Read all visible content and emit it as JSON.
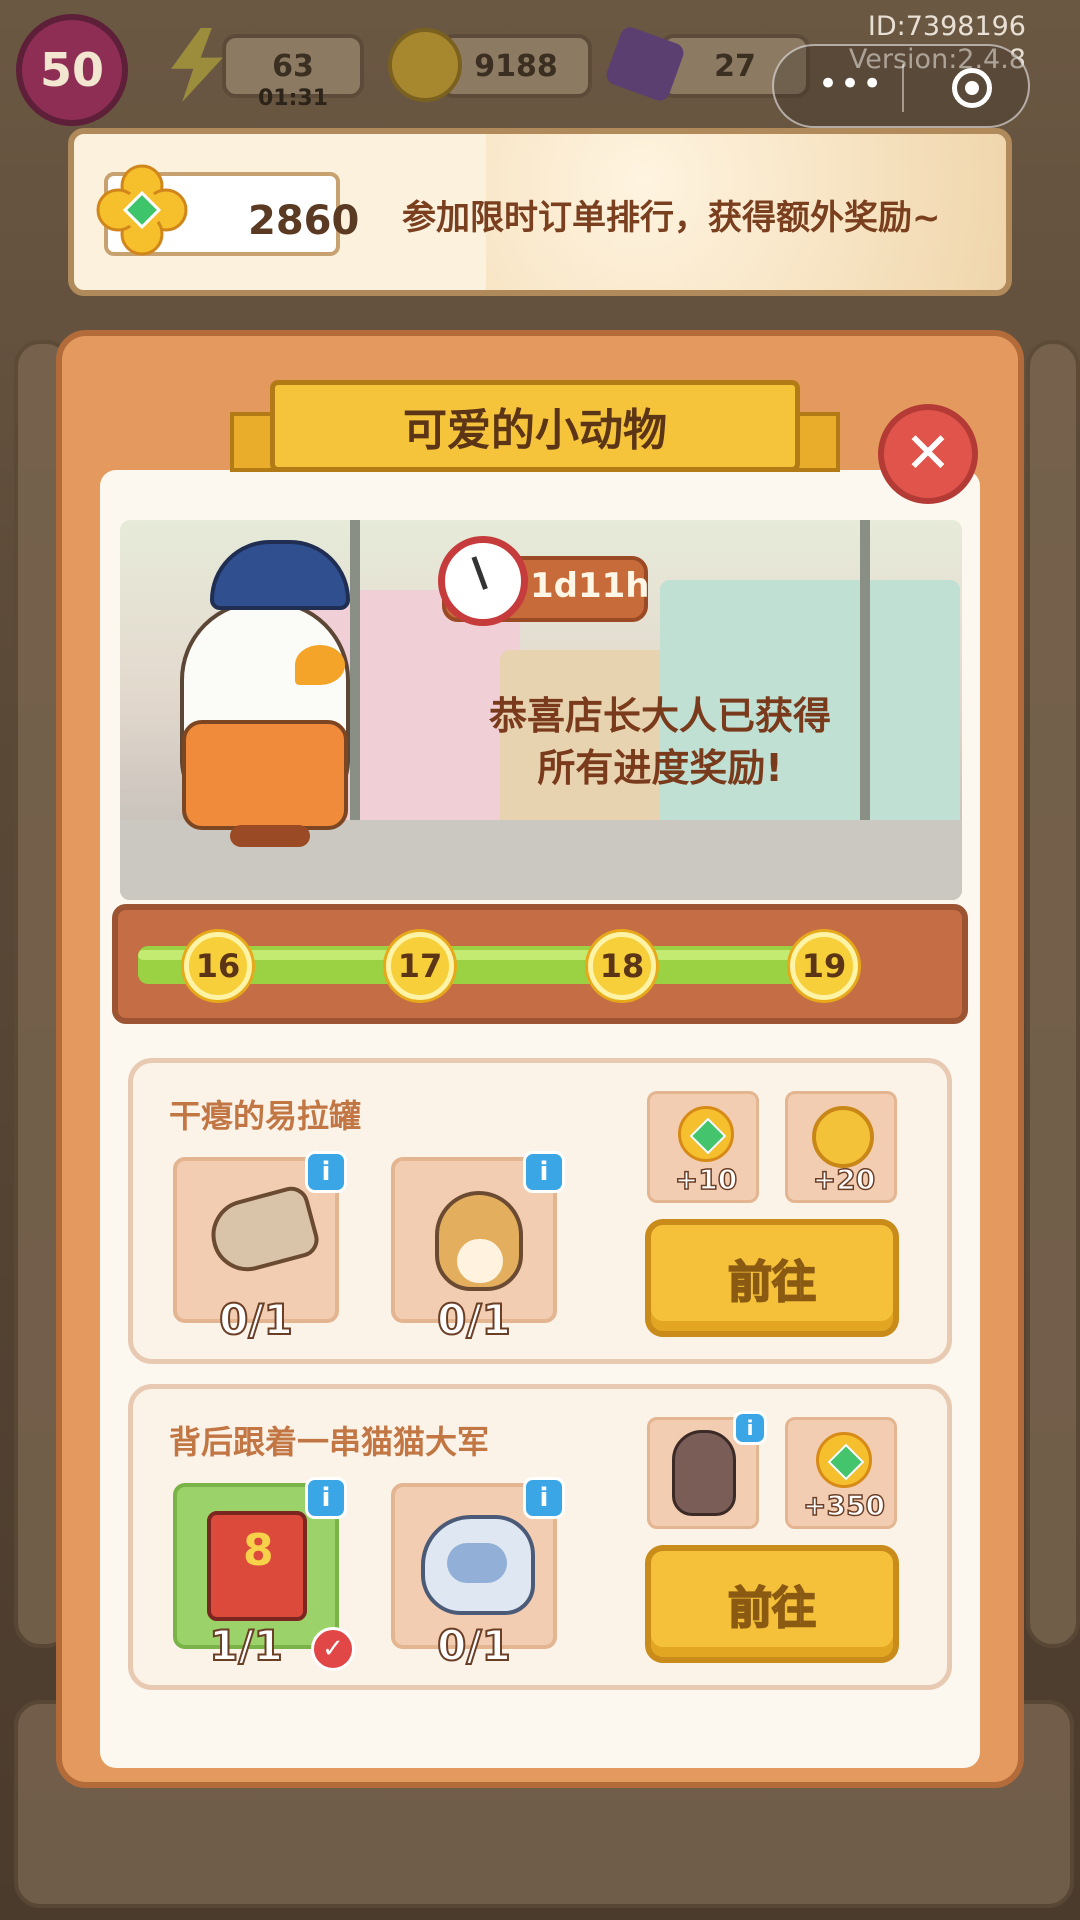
{
  "hud": {
    "level": "50",
    "energy": "63",
    "energy_timer": "01:31",
    "coins": "9188",
    "gems": "27",
    "user_id": "ID:7398196",
    "version": "Version:2.4.8"
  },
  "event_banner": {
    "score": "2860",
    "text": "参加限时订单排行，获得额外奖励~"
  },
  "modal": {
    "title": "可爱的小动物",
    "close_symbol": "✕",
    "timer": "1d11h",
    "message_line1": "恭喜店长大人已获得",
    "message_line2": "所有进度奖励!"
  },
  "progress": {
    "milestones": [
      "16",
      "17",
      "18",
      "19"
    ],
    "fill_fraction": 1.0
  },
  "tasks": [
    {
      "title": "干瘪的易拉罐",
      "items": [
        {
          "icon": "crushed-can-icon",
          "count": "0/1",
          "done": false
        },
        {
          "icon": "hamster-icon",
          "count": "0/1",
          "done": false
        }
      ],
      "rewards": [
        {
          "icon": "clover-icon",
          "value": "+10"
        },
        {
          "icon": "gold-coin-icon",
          "value": "+20"
        }
      ],
      "button": "前往"
    },
    {
      "title": "背后跟着一串猫猫大军",
      "items": [
        {
          "icon": "red-book-icon",
          "count": "1/1",
          "done": true
        },
        {
          "icon": "fluffy-cat-icon",
          "count": "0/1",
          "done": false
        }
      ],
      "rewards": [
        {
          "icon": "sphynx-cat-icon",
          "value": ""
        },
        {
          "icon": "clover-icon",
          "value": "+350"
        }
      ],
      "button": "前往"
    }
  ],
  "icons": {
    "info": "i",
    "check": "✓",
    "menu_dots": "•••"
  },
  "colors": {
    "modal_orange": "#e49a5f",
    "ribbon_yellow": "#f6c43b",
    "progress_green": "#9ad244",
    "button_yellow": "#f5c13a"
  }
}
